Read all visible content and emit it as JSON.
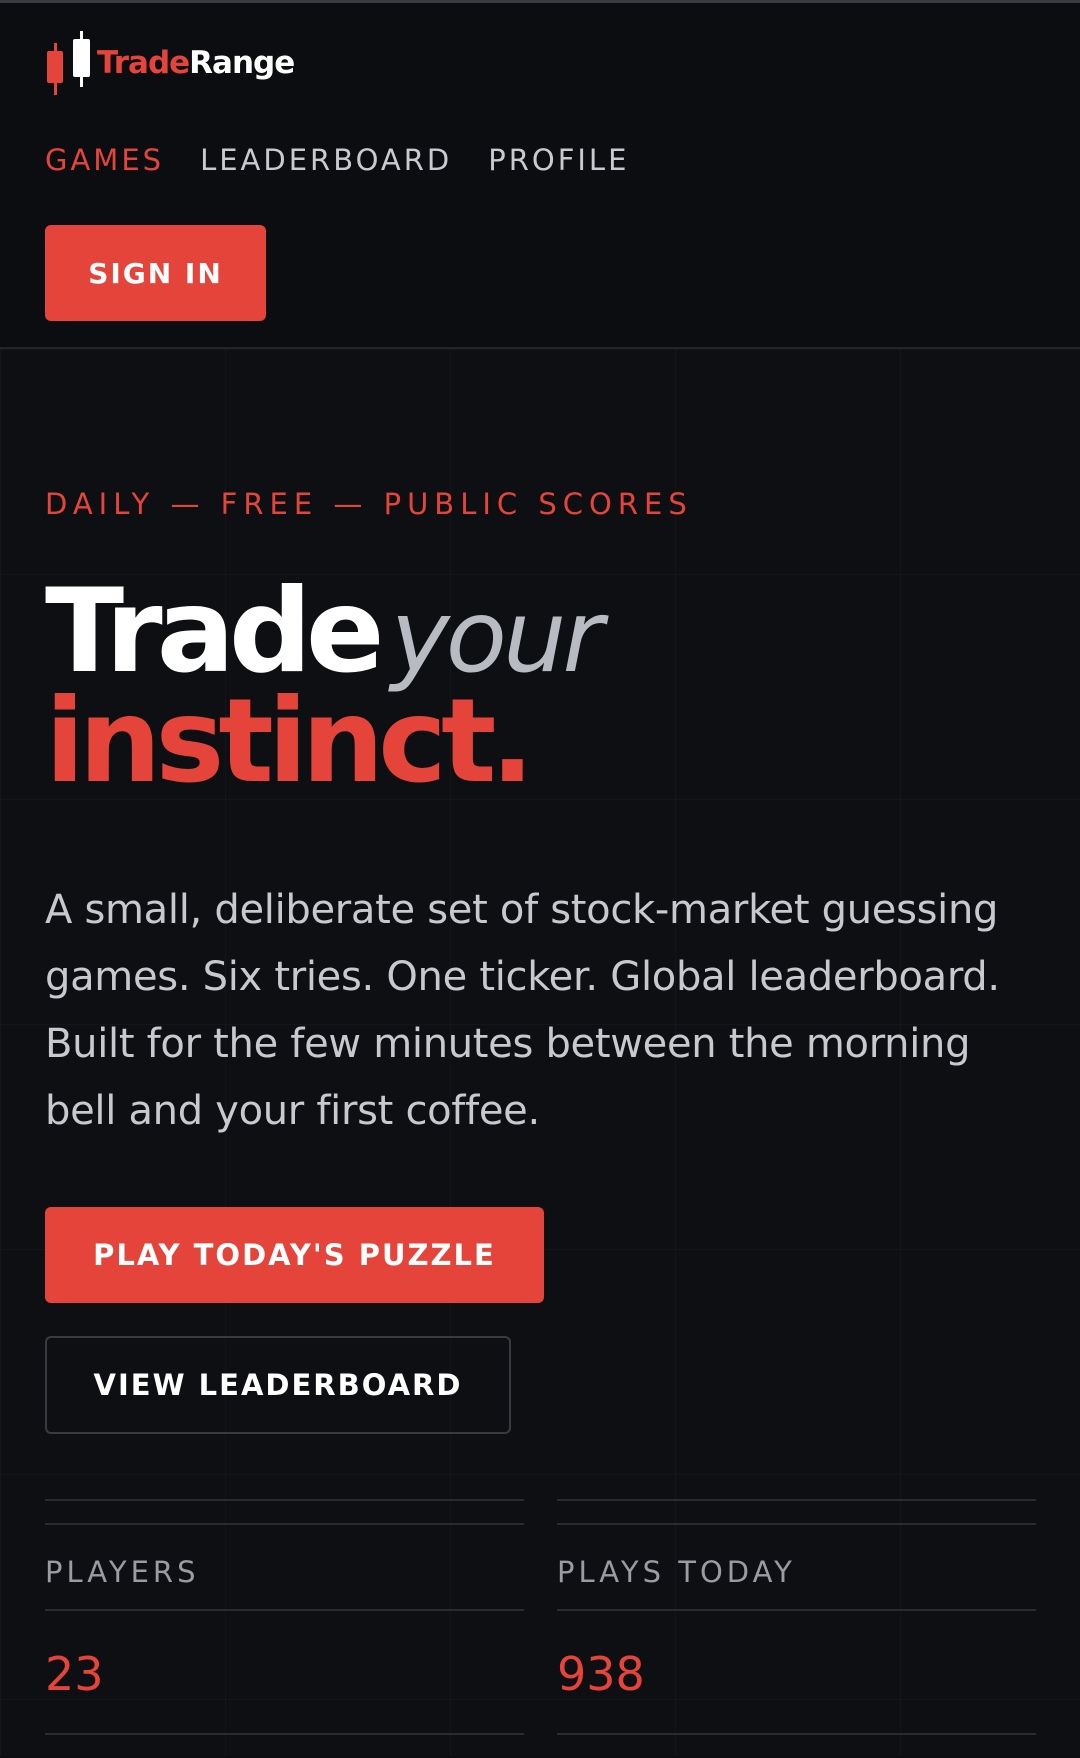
{
  "brand": {
    "name_part1": "Trade",
    "name_part2": "Range",
    "logo_icon": "candlestick-logo-icon"
  },
  "nav": {
    "items": [
      {
        "label": "GAMES",
        "active": true
      },
      {
        "label": "LEADERBOARD",
        "active": false
      },
      {
        "label": "PROFILE",
        "active": false
      }
    ],
    "signin_label": "SIGN IN"
  },
  "hero": {
    "eyebrow": "DAILY — FREE — PUBLIC SCORES",
    "headline_word1": "Trade",
    "headline_word2": "your",
    "headline_word3": "instinct.",
    "description": "A small, deliberate set of stock-market guessing games. Six tries. One ticker. Global leaderboard. Built for the few minutes between the morning bell and your first coffee.",
    "primary_cta": "PLAY TODAY'S PUZZLE",
    "secondary_cta": "VIEW LEADERBOARD"
  },
  "stats": [
    {
      "label": "PLAYERS",
      "value": "23"
    },
    {
      "label": "PLAYS TODAY",
      "value": "938"
    }
  ],
  "colors": {
    "accent": "#e5443a",
    "background": "#0c0d10",
    "text": "#e9e9ee"
  }
}
